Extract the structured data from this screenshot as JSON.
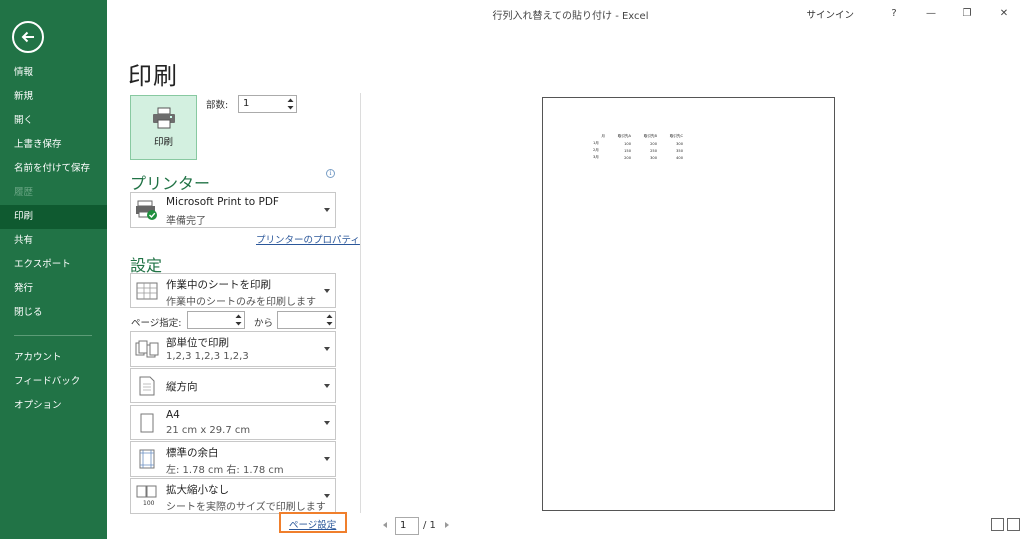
{
  "window": {
    "title": "行列入れ替えての貼り付け  -  Excel",
    "signin": "サインイン",
    "help": "?",
    "minimize": "—",
    "restore": "❐",
    "close": "✕"
  },
  "sidebar": {
    "items": [
      {
        "label": "情報"
      },
      {
        "label": "新規"
      },
      {
        "label": "開く"
      },
      {
        "label": "上書き保存"
      },
      {
        "label": "名前を付けて保存"
      },
      {
        "label": "履歴"
      },
      {
        "label": "印刷"
      },
      {
        "label": "共有"
      },
      {
        "label": "エクスポート"
      },
      {
        "label": "発行"
      },
      {
        "label": "閉じる"
      }
    ],
    "footer": [
      {
        "label": "アカウント"
      },
      {
        "label": "フィードバック"
      },
      {
        "label": "オプション"
      }
    ]
  },
  "print": {
    "page_title": "印刷",
    "print_button": "印刷",
    "copies_label": "部数:",
    "copies_value": "1",
    "printer_heading": "プリンター",
    "info_icon": "i",
    "printer_name": "Microsoft Print to PDF",
    "printer_status": "準備完了",
    "printer_properties": "プリンターのプロパティ",
    "settings_heading": "設定",
    "what_title": "作業中のシートを印刷",
    "what_sub": "作業中のシートのみを印刷します",
    "pages_label": "ページ指定:",
    "pages_to": "から",
    "collate_title": "部単位で印刷",
    "collate_sub": "1,2,3    1,2,3    1,2,3",
    "orientation": "縦方向",
    "paper_title": "A4",
    "paper_sub": "21 cm x 29.7 cm",
    "margins_title": "標準の余白",
    "margins_sub": "左:  1.78 cm    右:  1.78 cm",
    "scaling_title": "拡大縮小なし",
    "scaling_sub": "シートを実際のサイズで印刷します",
    "scaling_icon_text": "100",
    "page_setup": "ページ設定"
  },
  "preview": {
    "rows": [
      [
        "月",
        "取引先A",
        "取引先B",
        "取引先C"
      ],
      [
        "1月",
        "100",
        "200",
        "300"
      ],
      [
        "2月",
        "150",
        "250",
        "350"
      ],
      [
        "3月",
        "200",
        "300",
        "400"
      ]
    ],
    "current_page": "1",
    "total_pages": "/ 1"
  },
  "colors": {
    "sidebar": "#217346",
    "accent_green": "#217346",
    "highlight_orange": "#f07f2c",
    "link_blue": "#2b579a"
  }
}
